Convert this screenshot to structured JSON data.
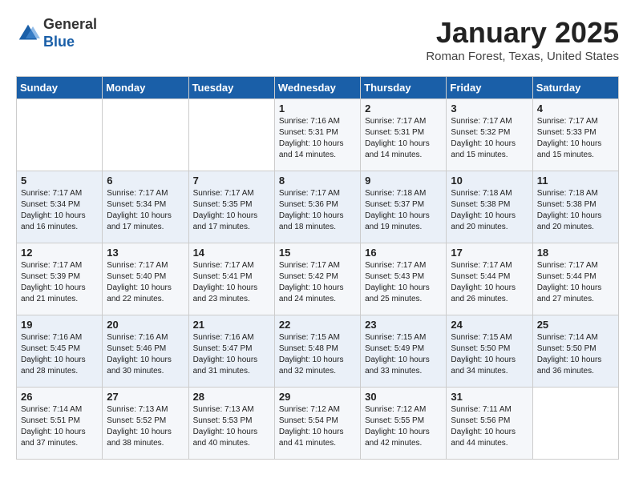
{
  "header": {
    "logo_general": "General",
    "logo_blue": "Blue",
    "month_title": "January 2025",
    "location": "Roman Forest, Texas, United States"
  },
  "days_of_week": [
    "Sunday",
    "Monday",
    "Tuesday",
    "Wednesday",
    "Thursday",
    "Friday",
    "Saturday"
  ],
  "weeks": [
    [
      {
        "day": "",
        "info": ""
      },
      {
        "day": "",
        "info": ""
      },
      {
        "day": "",
        "info": ""
      },
      {
        "day": "1",
        "info": "Sunrise: 7:16 AM\nSunset: 5:31 PM\nDaylight: 10 hours\nand 14 minutes."
      },
      {
        "day": "2",
        "info": "Sunrise: 7:17 AM\nSunset: 5:31 PM\nDaylight: 10 hours\nand 14 minutes."
      },
      {
        "day": "3",
        "info": "Sunrise: 7:17 AM\nSunset: 5:32 PM\nDaylight: 10 hours\nand 15 minutes."
      },
      {
        "day": "4",
        "info": "Sunrise: 7:17 AM\nSunset: 5:33 PM\nDaylight: 10 hours\nand 15 minutes."
      }
    ],
    [
      {
        "day": "5",
        "info": "Sunrise: 7:17 AM\nSunset: 5:34 PM\nDaylight: 10 hours\nand 16 minutes."
      },
      {
        "day": "6",
        "info": "Sunrise: 7:17 AM\nSunset: 5:34 PM\nDaylight: 10 hours\nand 17 minutes."
      },
      {
        "day": "7",
        "info": "Sunrise: 7:17 AM\nSunset: 5:35 PM\nDaylight: 10 hours\nand 17 minutes."
      },
      {
        "day": "8",
        "info": "Sunrise: 7:17 AM\nSunset: 5:36 PM\nDaylight: 10 hours\nand 18 minutes."
      },
      {
        "day": "9",
        "info": "Sunrise: 7:18 AM\nSunset: 5:37 PM\nDaylight: 10 hours\nand 19 minutes."
      },
      {
        "day": "10",
        "info": "Sunrise: 7:18 AM\nSunset: 5:38 PM\nDaylight: 10 hours\nand 20 minutes."
      },
      {
        "day": "11",
        "info": "Sunrise: 7:18 AM\nSunset: 5:38 PM\nDaylight: 10 hours\nand 20 minutes."
      }
    ],
    [
      {
        "day": "12",
        "info": "Sunrise: 7:17 AM\nSunset: 5:39 PM\nDaylight: 10 hours\nand 21 minutes."
      },
      {
        "day": "13",
        "info": "Sunrise: 7:17 AM\nSunset: 5:40 PM\nDaylight: 10 hours\nand 22 minutes."
      },
      {
        "day": "14",
        "info": "Sunrise: 7:17 AM\nSunset: 5:41 PM\nDaylight: 10 hours\nand 23 minutes."
      },
      {
        "day": "15",
        "info": "Sunrise: 7:17 AM\nSunset: 5:42 PM\nDaylight: 10 hours\nand 24 minutes."
      },
      {
        "day": "16",
        "info": "Sunrise: 7:17 AM\nSunset: 5:43 PM\nDaylight: 10 hours\nand 25 minutes."
      },
      {
        "day": "17",
        "info": "Sunrise: 7:17 AM\nSunset: 5:44 PM\nDaylight: 10 hours\nand 26 minutes."
      },
      {
        "day": "18",
        "info": "Sunrise: 7:17 AM\nSunset: 5:44 PM\nDaylight: 10 hours\nand 27 minutes."
      }
    ],
    [
      {
        "day": "19",
        "info": "Sunrise: 7:16 AM\nSunset: 5:45 PM\nDaylight: 10 hours\nand 28 minutes."
      },
      {
        "day": "20",
        "info": "Sunrise: 7:16 AM\nSunset: 5:46 PM\nDaylight: 10 hours\nand 30 minutes."
      },
      {
        "day": "21",
        "info": "Sunrise: 7:16 AM\nSunset: 5:47 PM\nDaylight: 10 hours\nand 31 minutes."
      },
      {
        "day": "22",
        "info": "Sunrise: 7:15 AM\nSunset: 5:48 PM\nDaylight: 10 hours\nand 32 minutes."
      },
      {
        "day": "23",
        "info": "Sunrise: 7:15 AM\nSunset: 5:49 PM\nDaylight: 10 hours\nand 33 minutes."
      },
      {
        "day": "24",
        "info": "Sunrise: 7:15 AM\nSunset: 5:50 PM\nDaylight: 10 hours\nand 34 minutes."
      },
      {
        "day": "25",
        "info": "Sunrise: 7:14 AM\nSunset: 5:50 PM\nDaylight: 10 hours\nand 36 minutes."
      }
    ],
    [
      {
        "day": "26",
        "info": "Sunrise: 7:14 AM\nSunset: 5:51 PM\nDaylight: 10 hours\nand 37 minutes."
      },
      {
        "day": "27",
        "info": "Sunrise: 7:13 AM\nSunset: 5:52 PM\nDaylight: 10 hours\nand 38 minutes."
      },
      {
        "day": "28",
        "info": "Sunrise: 7:13 AM\nSunset: 5:53 PM\nDaylight: 10 hours\nand 40 minutes."
      },
      {
        "day": "29",
        "info": "Sunrise: 7:12 AM\nSunset: 5:54 PM\nDaylight: 10 hours\nand 41 minutes."
      },
      {
        "day": "30",
        "info": "Sunrise: 7:12 AM\nSunset: 5:55 PM\nDaylight: 10 hours\nand 42 minutes."
      },
      {
        "day": "31",
        "info": "Sunrise: 7:11 AM\nSunset: 5:56 PM\nDaylight: 10 hours\nand 44 minutes."
      },
      {
        "day": "",
        "info": ""
      }
    ]
  ]
}
